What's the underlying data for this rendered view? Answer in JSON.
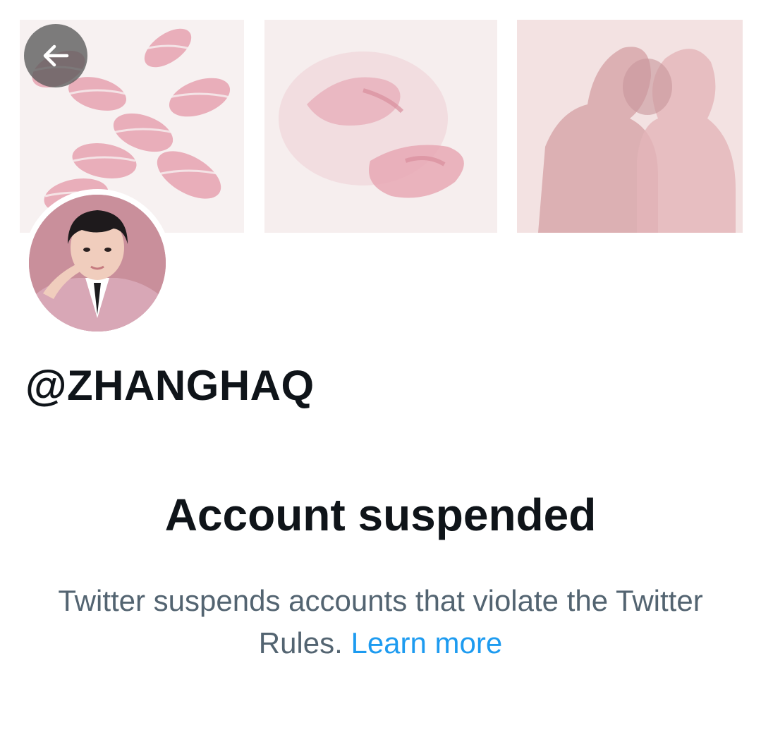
{
  "header": {
    "back_icon": "arrow-left-icon",
    "banner_images": [
      "lipstick-kisses-image",
      "watercolor-hands-image",
      "watercolor-kiss-image"
    ]
  },
  "profile": {
    "handle": "@ZHANGHAQ",
    "avatar": "profile-avatar-image"
  },
  "notice": {
    "title": "Account suspended",
    "description": "Twitter suspends accounts that violate the Twitter Rules.",
    "learn_more": "Learn more"
  },
  "colors": {
    "text_primary": "#0f1419",
    "text_secondary": "#536471",
    "link": "#1d9bf0",
    "avatar_bg": "#c98f9b"
  }
}
